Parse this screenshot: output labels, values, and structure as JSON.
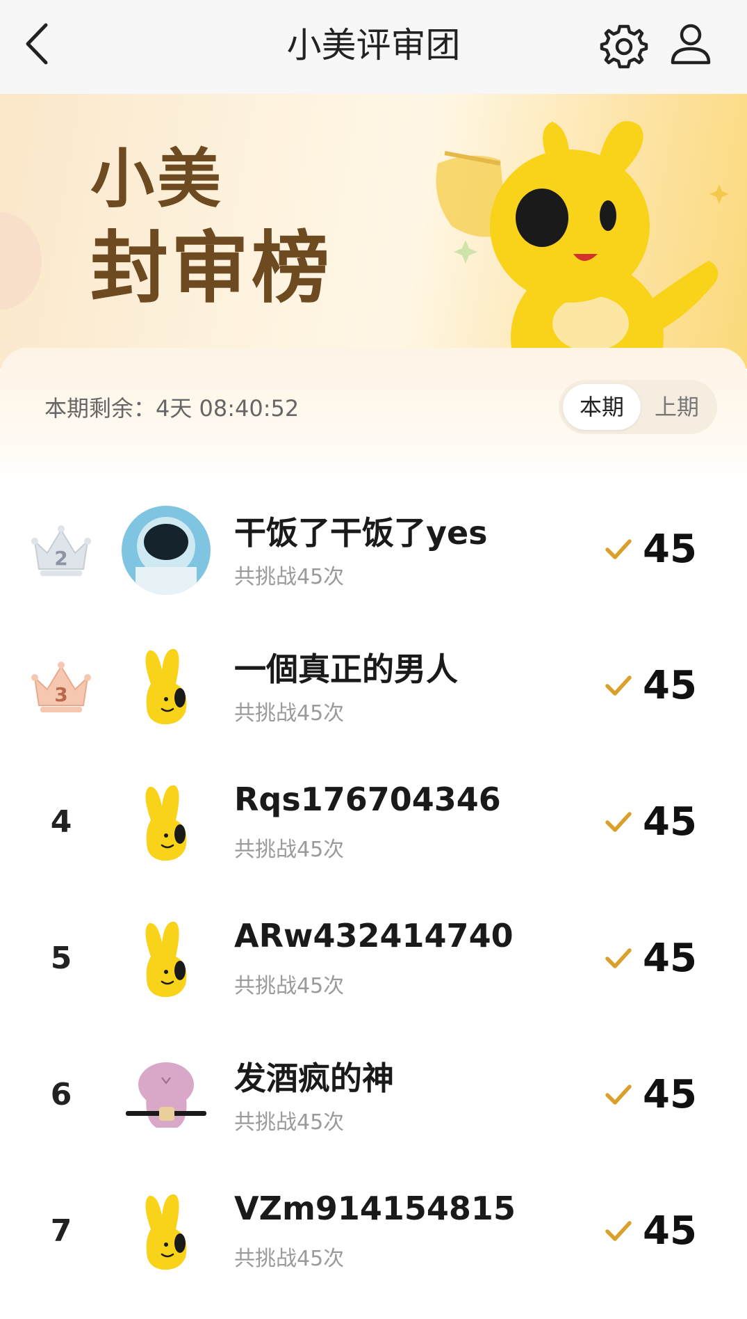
{
  "header": {
    "title": "小美评审团",
    "back_icon": "chevron-left-icon",
    "settings_icon": "gear-icon",
    "profile_icon": "user-icon"
  },
  "banner": {
    "title_line1": "小美",
    "title_line2": "封审榜"
  },
  "panel": {
    "countdown_text": "本期剩余：4天 08:40:52",
    "tabs": [
      {
        "label": "本期",
        "active": true
      },
      {
        "label": "上期",
        "active": false
      }
    ]
  },
  "leaderboard": [
    {
      "rank": "2",
      "badge": "silver-crown",
      "avatar": "astronaut-avatar",
      "name": "干饭了干饭了yes",
      "challenges": "共挑战45次",
      "score": "45"
    },
    {
      "rank": "3",
      "badge": "bronze-crown",
      "avatar": "mascot-avatar",
      "name": "一個真正的男人",
      "challenges": "共挑战45次",
      "score": "45"
    },
    {
      "rank": "4",
      "badge": "",
      "avatar": "mascot-avatar",
      "name": "Rqs176704346",
      "challenges": "共挑战45次",
      "score": "45"
    },
    {
      "rank": "5",
      "badge": "",
      "avatar": "mascot-avatar",
      "name": "ARw432414740",
      "challenges": "共挑战45次",
      "score": "45"
    },
    {
      "rank": "6",
      "badge": "",
      "avatar": "pink-character-avatar",
      "name": "发酒疯的神",
      "challenges": "共挑战45次",
      "score": "45"
    },
    {
      "rank": "7",
      "badge": "",
      "avatar": "mascot-avatar",
      "name": "VZm914154815",
      "challenges": "共挑战45次",
      "score": "45"
    }
  ],
  "colors": {
    "accent_gold": "#d9a12b",
    "banner_text": "#6e4a21",
    "mascot_yellow": "#f9d21a"
  }
}
